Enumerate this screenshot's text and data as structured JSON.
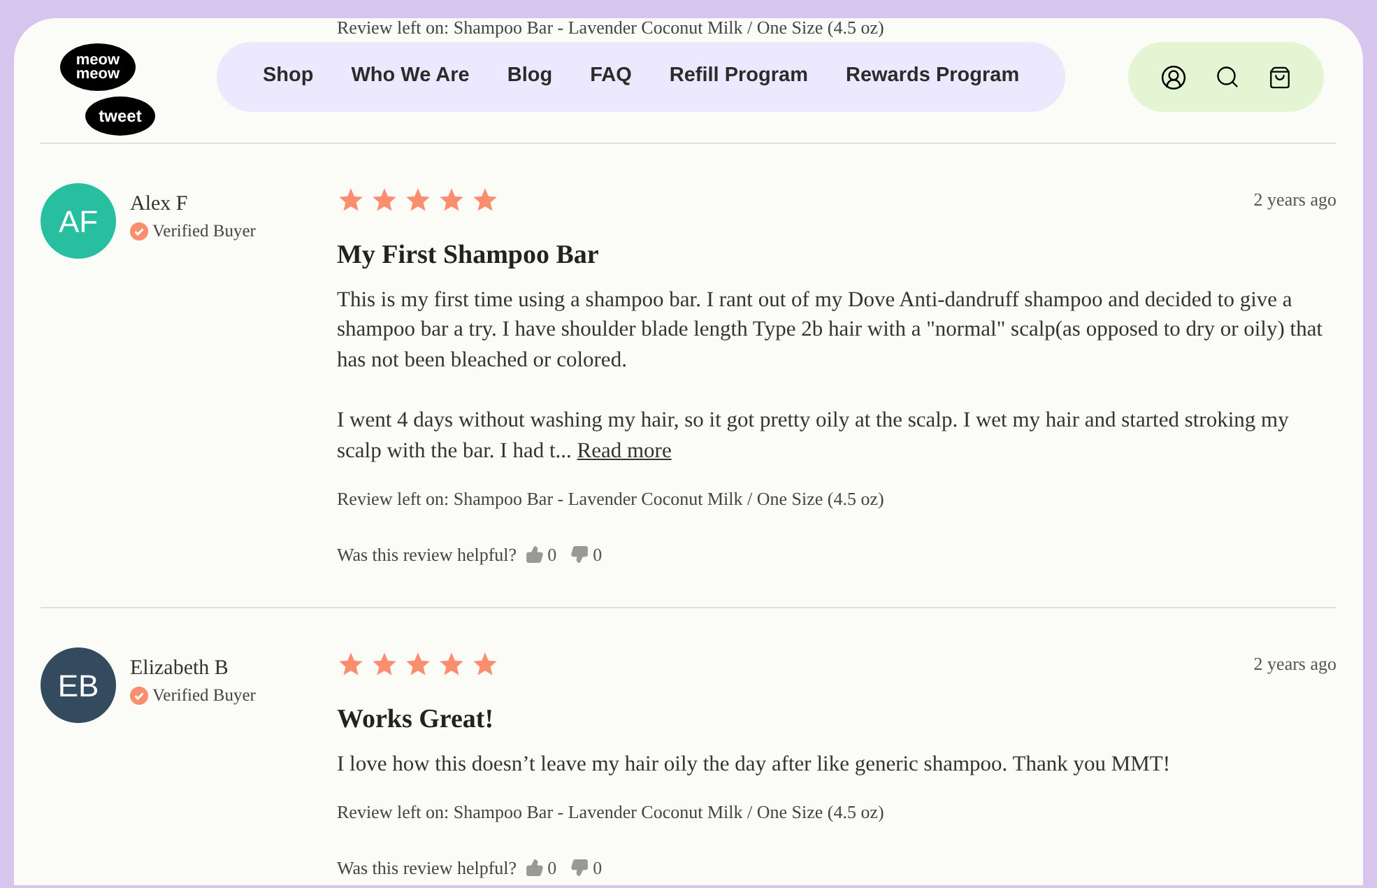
{
  "scrolled_text": "Review left on: Shampoo Bar - Lavender Coconut Milk / One Size (4.5 oz)",
  "logo": {
    "top": [
      "meow",
      "meow"
    ],
    "bottom": "tweet"
  },
  "nav": [
    "Shop",
    "Who We Are",
    "Blog",
    "FAQ",
    "Refill Program",
    "Rewards Program"
  ],
  "reviews": [
    {
      "initials": "AF",
      "color": "#27bf9f",
      "name": "Alex F",
      "badge": "Verified Buyer",
      "stars": 5,
      "date": "2 years ago",
      "title": "My First Shampoo Bar",
      "paragraphs": [
        "This is my first time using a shampoo bar. I rant out of my Dove Anti-dandruff shampoo and decided to give a shampoo bar a try. I have shoulder blade length Type 2b hair with a \"normal\" scalp(as opposed to dry or oily) that has not been bleached or colored.",
        "I went 4 days without washing my hair, so it got pretty oily at the scalp. I wet my hair and started stroking my scalp with the bar. I had t..."
      ],
      "read_more": "Read more",
      "product": "Review left on: Shampoo Bar - Lavender Coconut Milk / One Size (4.5 oz)",
      "helpful": "Was this review helpful?",
      "up": "0",
      "down": "0"
    },
    {
      "initials": "EB",
      "color": "#344a5e",
      "name": "Elizabeth B",
      "badge": "Verified Buyer",
      "stars": 5,
      "date": "2 years ago",
      "title": "Works Great!",
      "paragraphs": [
        "I love how this doesn’t leave my hair oily the day after like generic shampoo. Thank you MMT!"
      ],
      "product": "Review left on: Shampoo Bar - Lavender Coconut Milk / One Size (4.5 oz)",
      "helpful": "Was this review helpful?",
      "up": "0",
      "down": "0"
    }
  ]
}
